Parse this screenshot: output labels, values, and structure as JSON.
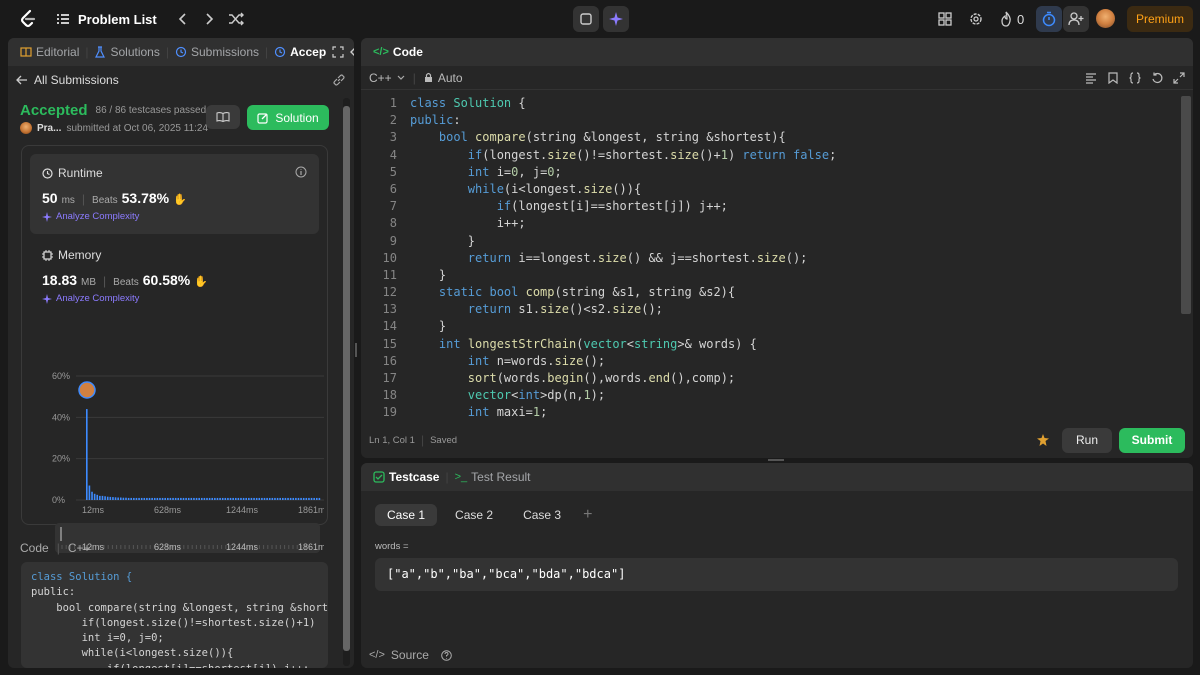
{
  "nav": {
    "title": "Problem List",
    "streak": "0",
    "premium": "Premium"
  },
  "left_panel": {
    "tabs": [
      {
        "label": "Editorial"
      },
      {
        "label": "Solutions"
      },
      {
        "label": "Submissions"
      },
      {
        "label": "Accep"
      }
    ],
    "back_label": "All Submissions",
    "status": "Accepted",
    "testcases": "86 / 86 testcases passed",
    "user": "Pra...",
    "submitted": "submitted at Oct 06, 2025 11:24",
    "solution_btn": "Solution",
    "runtime": {
      "title": "Runtime",
      "value": "50",
      "unit": "ms",
      "beats_label": "Beats",
      "beats": "53.78%",
      "analyze": "Analyze Complexity"
    },
    "memory": {
      "title": "Memory",
      "value": "18.83",
      "unit": "MB",
      "beats_label": "Beats",
      "beats": "60.58%",
      "analyze": "Analyze Complexity"
    },
    "code_label": "Code",
    "lang_label": "C++",
    "code_preview": [
      "class Solution {",
      "public:",
      "    bool compare(string &longest, string &short",
      "        if(longest.size()!=shortest.size()+1)",
      "        int i=0, j=0;",
      "        while(i<longest.size()){",
      "            if(longest[i]==shortest[j]) j++;"
    ]
  },
  "chart_data": {
    "type": "bar",
    "y_ticks": [
      "60%",
      "40%",
      "20%",
      "0%"
    ],
    "x_ticks": [
      "12ms",
      "628ms",
      "1244ms",
      "1861ms"
    ],
    "ylim": [
      0,
      60
    ],
    "values": [
      44,
      7,
      4,
      3,
      2.5,
      2,
      2,
      1.8,
      1.6,
      1.5,
      1.4,
      1.3,
      1.2,
      1.2,
      1.1,
      1.1,
      1,
      1,
      1,
      1,
      1,
      1,
      1,
      1,
      1,
      1,
      1,
      1,
      1,
      1,
      1,
      1,
      1,
      1,
      1,
      1,
      1,
      1,
      1,
      1,
      1,
      1,
      1,
      1,
      1,
      1,
      1,
      1,
      1,
      1,
      1,
      1,
      1,
      1,
      1,
      1,
      1,
      1,
      1,
      1,
      1,
      1,
      1,
      1,
      1,
      1,
      1,
      1,
      1,
      1,
      1,
      1,
      1,
      1,
      1,
      1,
      1,
      1,
      1,
      1,
      1,
      1,
      1,
      1,
      1,
      1,
      1,
      1,
      1,
      1
    ],
    "grid": true
  },
  "code_panel": {
    "title": "Code",
    "lang": "C++",
    "auto": "Auto",
    "status_pos": "Ln 1, Col 1",
    "status_saved": "Saved",
    "run": "Run",
    "submit": "Submit",
    "lines": [
      [
        [
          "kw",
          "class "
        ],
        [
          "ty",
          "Solution"
        ],
        [
          "tx",
          " {"
        ]
      ],
      [
        [
          "kw",
          "public"
        ],
        [
          "tx",
          ":"
        ]
      ],
      [
        [
          "tx",
          "    "
        ],
        [
          "kw",
          "bool "
        ],
        [
          "fn",
          "compare"
        ],
        [
          "tx",
          "(string &longest, string &shortest){"
        ]
      ],
      [
        [
          "tx",
          "        "
        ],
        [
          "kw",
          "if"
        ],
        [
          "tx",
          "(longest."
        ],
        [
          "fn",
          "size"
        ],
        [
          "tx",
          "()!=shortest."
        ],
        [
          "fn",
          "size"
        ],
        [
          "tx",
          "()+"
        ],
        [
          "nm",
          "1"
        ],
        [
          "tx",
          ") "
        ],
        [
          "kw",
          "return false"
        ],
        [
          "tx",
          ";"
        ]
      ],
      [
        [
          "tx",
          "        "
        ],
        [
          "kw",
          "int "
        ],
        [
          "tx",
          "i="
        ],
        [
          "nm",
          "0"
        ],
        [
          "tx",
          ", j="
        ],
        [
          "nm",
          "0"
        ],
        [
          "tx",
          ";"
        ]
      ],
      [
        [
          "tx",
          "        "
        ],
        [
          "kw",
          "while"
        ],
        [
          "tx",
          "(i<longest."
        ],
        [
          "fn",
          "size"
        ],
        [
          "tx",
          "()){"
        ]
      ],
      [
        [
          "tx",
          "            "
        ],
        [
          "kw",
          "if"
        ],
        [
          "tx",
          "(longest[i]==shortest[j]) j++;"
        ]
      ],
      [
        [
          "tx",
          "            i++;"
        ]
      ],
      [
        [
          "tx",
          "        }"
        ]
      ],
      [
        [
          "tx",
          "        "
        ],
        [
          "kw",
          "return "
        ],
        [
          "tx",
          "i==longest."
        ],
        [
          "fn",
          "size"
        ],
        [
          "tx",
          "() && j==shortest."
        ],
        [
          "fn",
          "size"
        ],
        [
          "tx",
          "();"
        ]
      ],
      [
        [
          "tx",
          "    }"
        ]
      ],
      [
        [
          "tx",
          "    "
        ],
        [
          "kw",
          "static bool "
        ],
        [
          "fn",
          "comp"
        ],
        [
          "tx",
          "(string &s1, string &s2){"
        ]
      ],
      [
        [
          "tx",
          "        "
        ],
        [
          "kw",
          "return "
        ],
        [
          "tx",
          "s1."
        ],
        [
          "fn",
          "size"
        ],
        [
          "tx",
          "()<s2."
        ],
        [
          "fn",
          "size"
        ],
        [
          "tx",
          "();"
        ]
      ],
      [
        [
          "tx",
          "    }"
        ]
      ],
      [
        [
          "tx",
          "    "
        ],
        [
          "kw",
          "int "
        ],
        [
          "fn",
          "longestStrChain"
        ],
        [
          "tx",
          "("
        ],
        [
          "ty",
          "vector"
        ],
        [
          "tx",
          "<"
        ],
        [
          "ty",
          "string"
        ],
        [
          "tx",
          ">& words) {"
        ]
      ],
      [
        [
          "tx",
          "        "
        ],
        [
          "kw",
          "int "
        ],
        [
          "tx",
          "n=words."
        ],
        [
          "fn",
          "size"
        ],
        [
          "tx",
          "();"
        ]
      ],
      [
        [
          "tx",
          "        "
        ],
        [
          "fn",
          "sort"
        ],
        [
          "tx",
          "(words."
        ],
        [
          "fn",
          "begin"
        ],
        [
          "tx",
          "(),words."
        ],
        [
          "fn",
          "end"
        ],
        [
          "tx",
          "(),comp);"
        ]
      ],
      [
        [
          "tx",
          "        "
        ],
        [
          "ty",
          "vector"
        ],
        [
          "tx",
          "<"
        ],
        [
          "kw",
          "int"
        ],
        [
          "tx",
          ">dp(n,"
        ],
        [
          "nm",
          "1"
        ],
        [
          "tx",
          ");"
        ]
      ],
      [
        [
          "tx",
          "        "
        ],
        [
          "kw",
          "int "
        ],
        [
          "tx",
          "maxi="
        ],
        [
          "nm",
          "1"
        ],
        [
          "tx",
          ";"
        ]
      ]
    ]
  },
  "test_panel": {
    "tab_testcase": "Testcase",
    "tab_result": "Test Result",
    "cases": [
      "Case 1",
      "Case 2",
      "Case 3"
    ],
    "input_label": "words =",
    "input_value": "[\"a\",\"b\",\"ba\",\"bca\",\"bda\",\"bdca\"]",
    "source": "Source"
  }
}
